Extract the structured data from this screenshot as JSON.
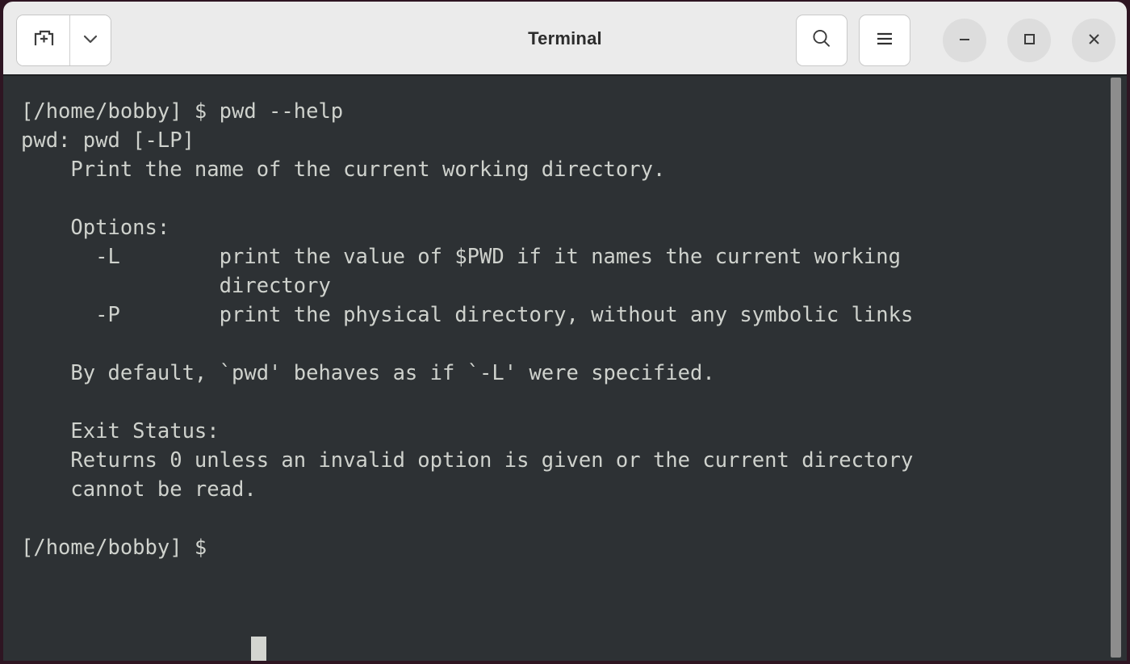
{
  "window": {
    "title": "Terminal",
    "frame_color": "#2e1522",
    "header_bg": "#ebebeb",
    "terminal_bg": "#2d3134",
    "terminal_fg": "#cfd2cd",
    "cursor_color": "#d3d5d0",
    "scrollbar_color": "#8d8d8d"
  },
  "header": {
    "new_tab_label": "new-tab-icon",
    "new_tab_dropdown_label": "chevron-down-icon",
    "search_label": "search-icon",
    "menu_label": "hamburger-menu-icon",
    "minimize_label": "minimize-icon",
    "maximize_label": "maximize-icon",
    "close_label": "close-icon"
  },
  "terminal": {
    "prompt": "[/home/bobby] $ ",
    "command": "pwd --help",
    "cursor_visible": true,
    "lines": [
      "[/home/bobby] $ pwd --help",
      "pwd: pwd [-LP]",
      "    Print the name of the current working directory.",
      "",
      "    Options:",
      "      -L        print the value of $PWD if it names the current working",
      "                directory",
      "      -P        print the physical directory, without any symbolic links",
      "",
      "    By default, `pwd' behaves as if `-L' were specified.",
      "",
      "    Exit Status:",
      "    Returns 0 unless an invalid option is given or the current directory",
      "    cannot be read.",
      "",
      "[/home/bobby] $ "
    ],
    "content": "[/home/bobby] $ pwd --help\npwd: pwd [-LP]\n    Print the name of the current working directory.\n\n    Options:\n      -L        print the value of $PWD if it names the current working\n                directory\n      -P        print the physical directory, without any symbolic links\n\n    By default, `pwd' behaves as if `-L' were specified.\n\n    Exit Status:\n    Returns 0 unless an invalid option is given or the current directory\n    cannot be read.\n\n[/home/bobby] $ "
  }
}
